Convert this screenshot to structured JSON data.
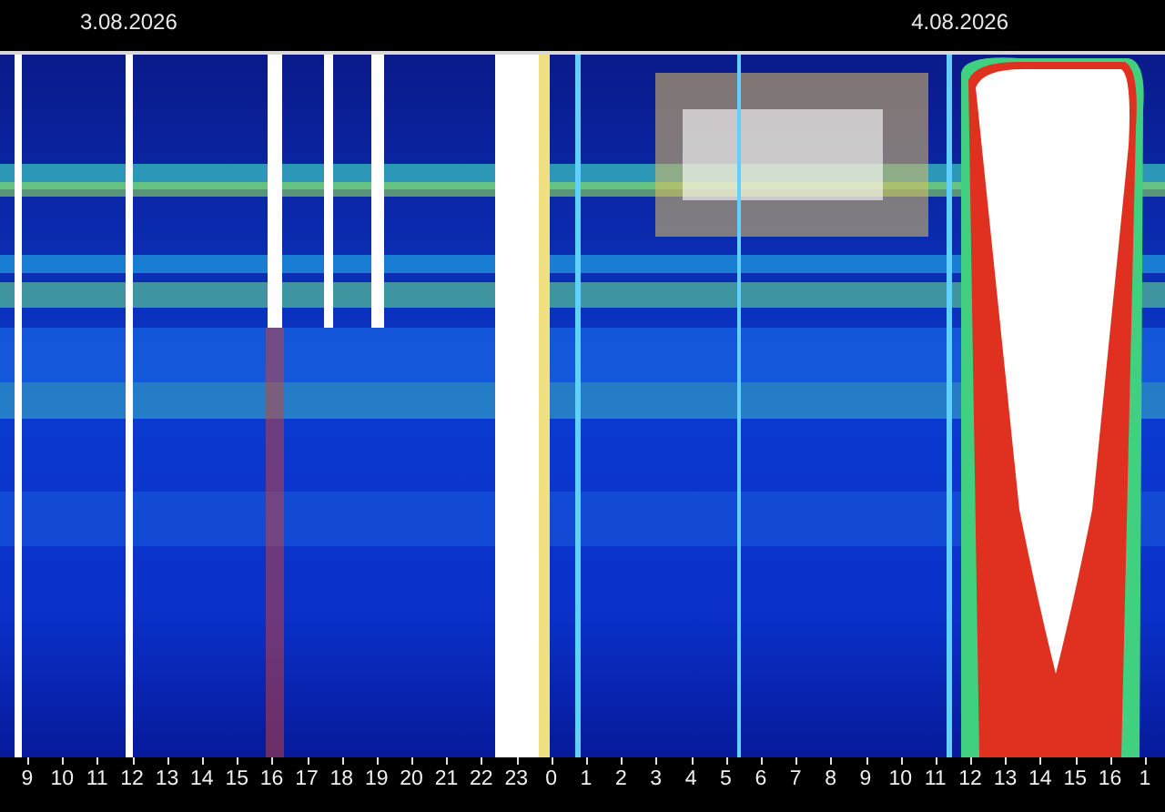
{
  "dates": [
    "3.08.2026",
    "4.08.2026"
  ],
  "hour_ticks": [
    "9",
    "10",
    "11",
    "12",
    "13",
    "14",
    "15",
    "16",
    "17",
    "18",
    "19",
    "20",
    "21",
    "22",
    "23",
    "0",
    "1",
    "2",
    "3",
    "4",
    "5",
    "6",
    "7",
    "8",
    "9",
    "10",
    "11",
    "12",
    "13",
    "14",
    "15",
    "16",
    "1"
  ]
}
